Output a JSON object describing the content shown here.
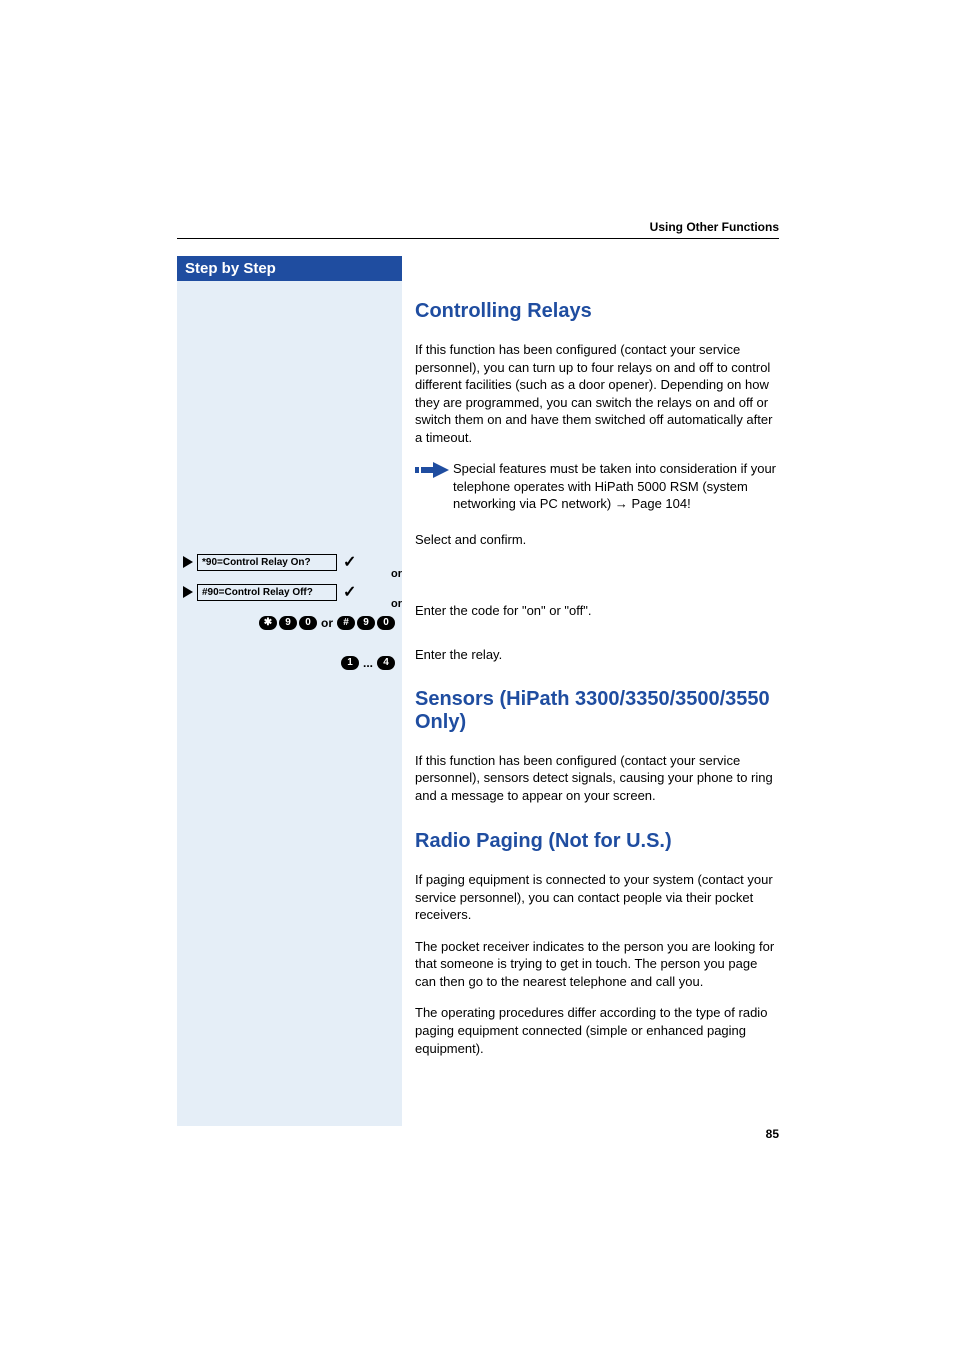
{
  "header": {
    "breadcrumb": "Using Other Functions"
  },
  "sidebar": {
    "title": "Step by Step",
    "option1": "*90=Control Relay On?",
    "or1": "or",
    "option2": "#90=Control Relay Off?",
    "or2": "or",
    "keys_or": "or",
    "keys_dots": "..."
  },
  "section1": {
    "title": "Controlling Relays",
    "p1": "If this function has been configured (contact your service personnel), you can turn up to four relays on and off to control different facilities (such as a door opener). Depending on how they are programmed, you can switch the relays on and off or switch them on and have them switched off automatically after a timeout.",
    "note": "Special features must be taken into consideration if your telephone operates with HiPath 5000 RSM (system networking via PC network) → Page 104!",
    "instr1": "Select and confirm.",
    "instr2": "Enter the code for \"on\" or \"off\".",
    "instr3": "Enter the relay."
  },
  "section2": {
    "title": "Sensors (HiPath 3300/3350/3500/3550 Only)",
    "p1": "If this function has been configured (contact your service personnel), sensors detect signals, causing your phone to ring and a message to appear on your screen."
  },
  "section3": {
    "title": "Radio Paging (Not for U.S.)",
    "p1": "If paging equipment is connected to your system (contact your service personnel), you can contact people via their pocket receivers.",
    "p2": "The pocket receiver indicates to the person you are looking for that someone is trying to get in touch. The person you page can then go to the nearest telephone and call you.",
    "p3": "The operating procedures differ according to the type of radio paging equipment connected (simple or enhanced paging equipment)."
  },
  "page": {
    "number": "85"
  },
  "keys": {
    "star": "✱",
    "hash": "#",
    "nine": "9",
    "zero": "0",
    "one": "1",
    "four": "4"
  }
}
